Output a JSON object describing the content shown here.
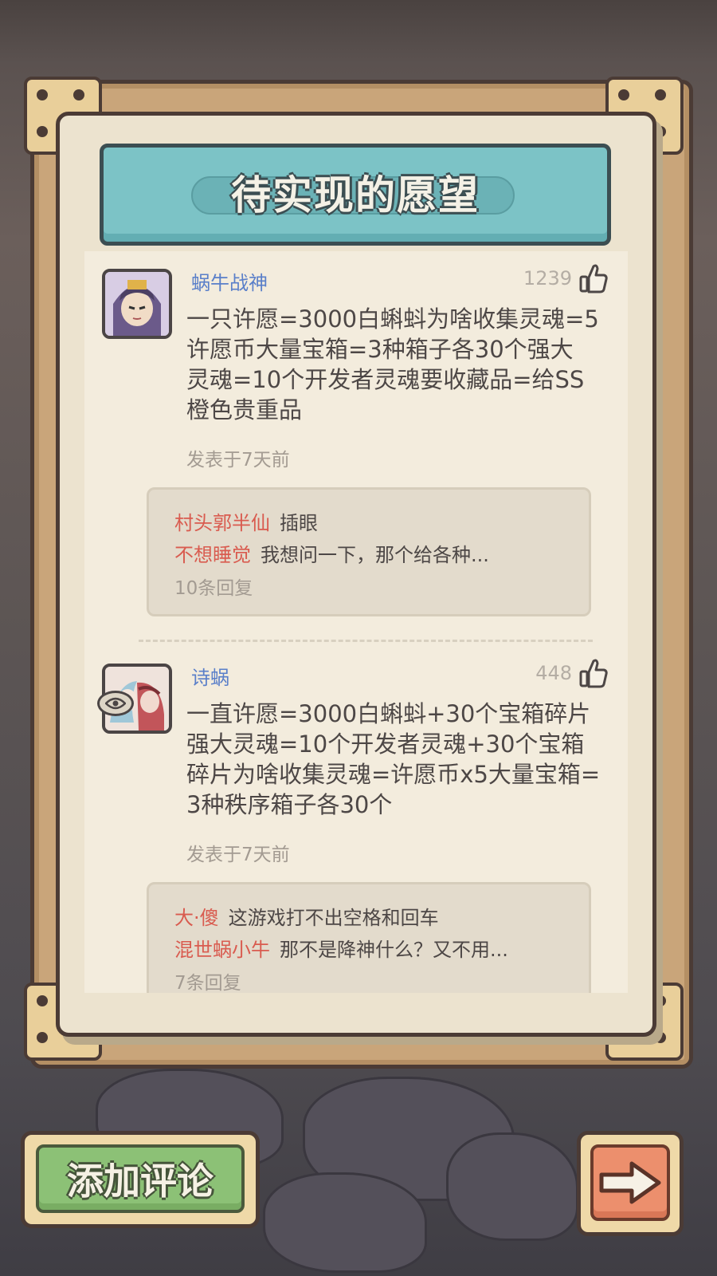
{
  "title": "待实现的愿望",
  "comments": [
    {
      "username": "蜗牛战神",
      "likes": "1239",
      "text_lines": [
        "一只许愿=3000白蝌蚪为啥收集灵魂=5",
        "许愿币大量宝箱=3种箱子各30个强大",
        "灵魂=10个开发者灵魂要收藏品=给SS",
        "橙色贵重品"
      ],
      "time": "发表于7天前",
      "replies": [
        {
          "name": "村头郭半仙",
          "text": "插眼"
        },
        {
          "name": "不想睡觉",
          "text": "我想问一下，那个给各种..."
        }
      ],
      "reply_count": "10条回复"
    },
    {
      "username": "诗蜗",
      "likes": "448",
      "text_lines": [
        "一直许愿=3000白蝌蚪+30个宝箱碎片",
        "强大灵魂=10个开发者灵魂+30个宝箱",
        "碎片为啥收集灵魂=许愿币x5大量宝箱=",
        "3种秩序箱子各30个"
      ],
      "time": "发表于7天前",
      "replies": [
        {
          "name": "大·傻",
          "text": "这游戏打不出空格和回车"
        },
        {
          "name": "混世蜗小牛",
          "text": "那不是降神什么？又不用..."
        }
      ],
      "reply_count": "7条回复"
    }
  ],
  "buttons": {
    "add_comment": "添加评论",
    "next_icon": "arrow-right-icon"
  },
  "colors": {
    "banner": "#7cc3c6",
    "username": "#5a7fc9",
    "reply_name": "#d95b4f",
    "add_button": "#8cc176",
    "next_button": "#ec8f6d"
  }
}
